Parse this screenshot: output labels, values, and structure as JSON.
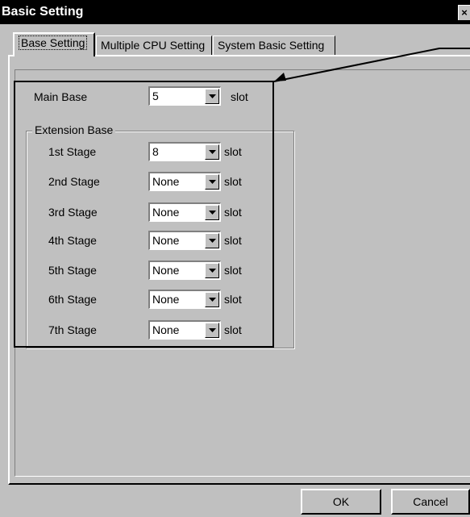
{
  "window": {
    "title": "Basic Setting",
    "close_glyph": "×"
  },
  "tabs": [
    {
      "label": "Base Setting",
      "active": true
    },
    {
      "label": "Multiple CPU Setting",
      "active": false
    },
    {
      "label": "System Basic Setting",
      "active": false
    }
  ],
  "main_base": {
    "label": "Main Base",
    "value": "5",
    "unit": "slot"
  },
  "extension_base": {
    "title": "Extension Base",
    "stages": [
      {
        "label": "1st Stage",
        "value": "8",
        "unit": "slot"
      },
      {
        "label": "2nd Stage",
        "value": "None",
        "unit": "slot"
      },
      {
        "label": "3rd Stage",
        "value": "None",
        "unit": "slot"
      },
      {
        "label": "4th Stage",
        "value": "None",
        "unit": "slot"
      },
      {
        "label": "5th Stage",
        "value": "None",
        "unit": "slot"
      },
      {
        "label": "6th Stage",
        "value": "None",
        "unit": "slot"
      },
      {
        "label": "7th Stage",
        "value": "None",
        "unit": "slot"
      }
    ]
  },
  "buttons": {
    "ok": "OK",
    "cancel": "Cancel"
  },
  "icons": {
    "dropdown": "dropdown-arrow-icon",
    "close": "close-icon"
  }
}
